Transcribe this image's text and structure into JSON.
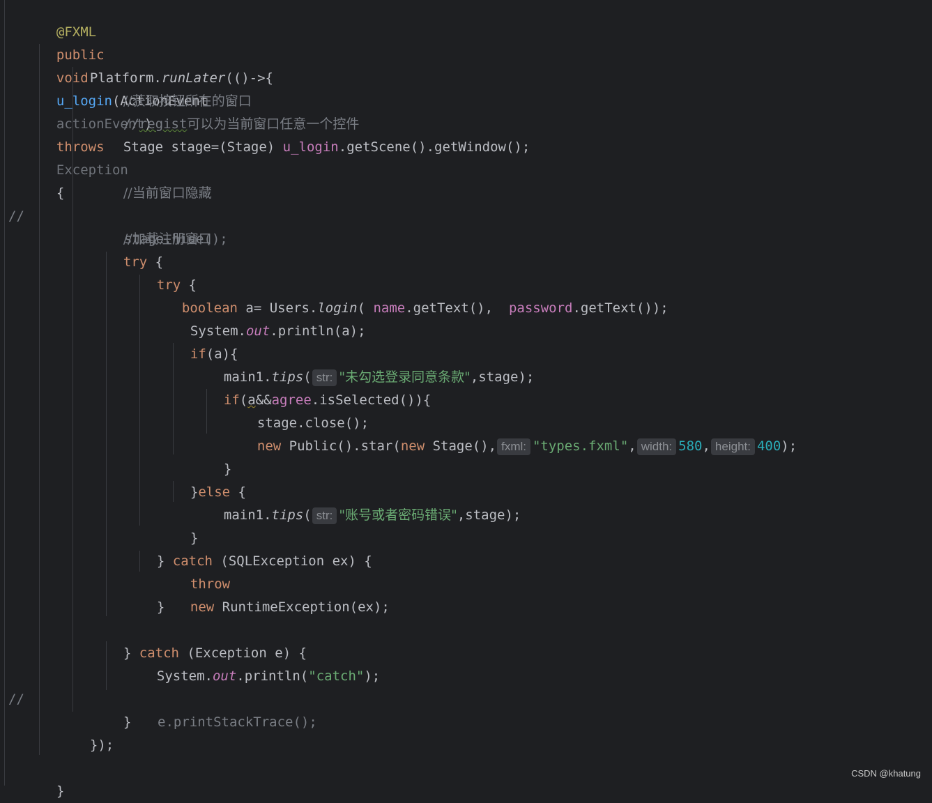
{
  "editor": {
    "l1": {
      "annotation": "@FXML"
    },
    "l2": {
      "public": "public",
      "void": "void",
      "method": "u_login",
      "open": "(",
      "type": "ActionEvent",
      "param": "actionEvent",
      "close": ")",
      "throws": "throws",
      "exc": "Exception",
      "brace": "{"
    },
    "l3": {
      "a": "Platform.",
      "b": "runLater",
      "c": "(()->{"
    },
    "l4": {
      "comment": "//获取按钮所在的窗口"
    },
    "l5": {
      "slashes": "//",
      "regist": "regist",
      "rest": "可以为当前窗口任意一个控件"
    },
    "l6": {
      "a": "Stage stage=(Stage) ",
      "b": "u_login",
      "c": ".getScene().getWindow();"
    },
    "l7": {
      "comment": "//当前窗口隐藏"
    },
    "l8": {
      "marker": "//",
      "code": "stage.hide();"
    },
    "l9": {
      "comment": "//加载注册窗口"
    },
    "l10": {
      "kw": "try",
      "rest": " {"
    },
    "l11": {
      "kw": "try",
      "rest": " {"
    },
    "l12": {
      "kw": "boolean",
      "a": " a= Users.",
      "b": "login",
      "c": "( ",
      "d": "name",
      "e": ".getText(),  ",
      "f": "password",
      "g": ".getText());"
    },
    "l13": {
      "a": "System.",
      "b": "out",
      "c": ".println(a);"
    },
    "l14": {
      "kw": "if",
      "rest": "(a){"
    },
    "l15": {
      "a": "main1.",
      "b": "tips",
      "c": "(",
      "hint": "str:",
      "str": "\"未勾选登录同意条款\"",
      "d": ",stage);"
    },
    "l16": {
      "kw": "if",
      "a": "(",
      "b": "a",
      "c": "&&",
      "d": "agree",
      "e": ".isSelected()){"
    },
    "l17": {
      "code": "stage.close();"
    },
    "l18": {
      "new1": "new",
      "a": " Public().star(",
      "new2": "new",
      "b": " Stage(),",
      "hint1": "fxml:",
      "str": "\"types.fxml\"",
      "c": ",",
      "hint2": "width:",
      "n1": "580",
      "d": ",",
      "hint3": "height:",
      "n2": "400",
      "e": ");"
    },
    "l19": {
      "code": "}"
    },
    "l20": {
      "a": "}",
      "kw": "else",
      "b": " {"
    },
    "l21": {
      "a": "main1.",
      "b": "tips",
      "c": "(",
      "hint": "str:",
      "str": "\"账号或者密码错误\"",
      "d": ",stage);"
    },
    "l22": {
      "code": "}"
    },
    "l23": {
      "a": "} ",
      "kw": "catch",
      "b": " (SQLException ex) {"
    },
    "l24": {
      "kw1": "throw",
      "kw2": "new",
      "rest": " RuntimeException(ex);"
    },
    "l25": {
      "code": "}"
    },
    "l27": {
      "a": "} ",
      "kw": "catch",
      "b": " (Exception e) {"
    },
    "l28": {
      "a": "System.",
      "b": "out",
      "c": ".println(",
      "str": "\"catch\"",
      "d": ");"
    },
    "l29": {
      "marker": "//",
      "code": "e.printStackTrace();"
    },
    "l30": {
      "code": "}"
    },
    "l31": {
      "code": "});"
    },
    "l33": {
      "code": "}"
    }
  },
  "watermark": "CSDN @khatung",
  "colors": {
    "background": "#1e1f22",
    "keyword": "#cf8e6d",
    "string": "#6aab73",
    "number": "#2aacb8",
    "method": "#56a8f5",
    "field": "#c77dbb",
    "comment": "#7a7e85",
    "annotation": "#b3ae60"
  }
}
